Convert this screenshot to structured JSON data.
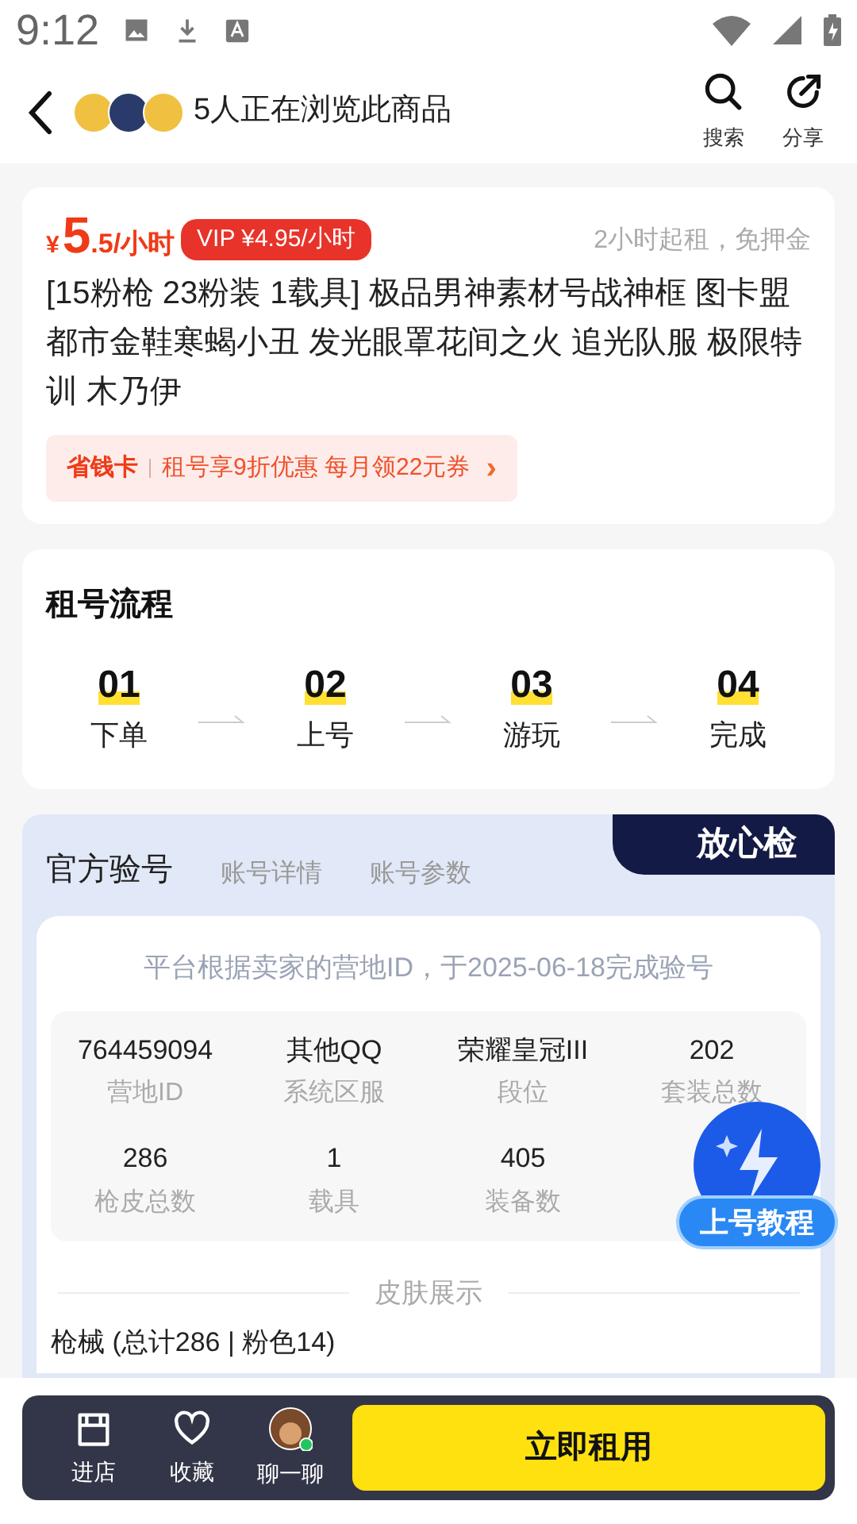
{
  "status_bar": {
    "time": "9:12"
  },
  "header": {
    "viewers": "5人正在浏览此商品",
    "actions": [
      {
        "kind": "search",
        "label": "搜索"
      },
      {
        "kind": "share",
        "label": "分享"
      }
    ]
  },
  "product": {
    "currency": "¥",
    "price_int": "5",
    "price_rest": ".5/小时",
    "vip_price": "VIP ¥4.95/小时",
    "terms": "2小时起租，免押金",
    "title": "[15粉枪 23粉装 1载具] 极品男神素材号战神框 图卡盟都市金鞋寒蝎小丑 发光眼罩花间之火 追光队服 极限特训 木乃伊",
    "promo_tag": "省钱卡",
    "promo_text": "租号享9折优惠 每月领22元券",
    "promo_arrow": "›"
  },
  "process": {
    "title": "租号流程",
    "steps": [
      {
        "number": "01",
        "label": "下单"
      },
      {
        "number": "02",
        "label": "上号"
      },
      {
        "number": "03",
        "label": "游玩"
      },
      {
        "number": "04",
        "label": "完成"
      }
    ]
  },
  "verify": {
    "tabs": [
      {
        "label": "官方验号",
        "selected": true
      },
      {
        "label": "账号详情",
        "selected": false
      },
      {
        "label": "账号参数",
        "selected": false
      }
    ],
    "badge": "放心检",
    "note": "平台根据卖家的营地ID，于2025-06-18完成验号",
    "stats": [
      {
        "value": "764459094",
        "label": "营地ID"
      },
      {
        "value": "其他QQ",
        "label": "系统区服"
      },
      {
        "value": "荣耀皇冠III",
        "label": "段位"
      },
      {
        "value": "202",
        "label": "套装总数"
      },
      {
        "value": "286",
        "label": "枪皮总数"
      },
      {
        "value": "1",
        "label": "载具"
      },
      {
        "value": "405",
        "label": "装备数"
      }
    ],
    "section_title": "皮肤展示",
    "category": "枪械 (总计286 | 粉色14)"
  },
  "float_button": {
    "label": "上号教程"
  },
  "bottom_bar": {
    "actions": [
      {
        "kind": "shop",
        "label": "进店"
      },
      {
        "kind": "favorite",
        "label": "收藏"
      },
      {
        "kind": "chat",
        "label": "聊一聊"
      }
    ],
    "primary": "立即租用"
  }
}
